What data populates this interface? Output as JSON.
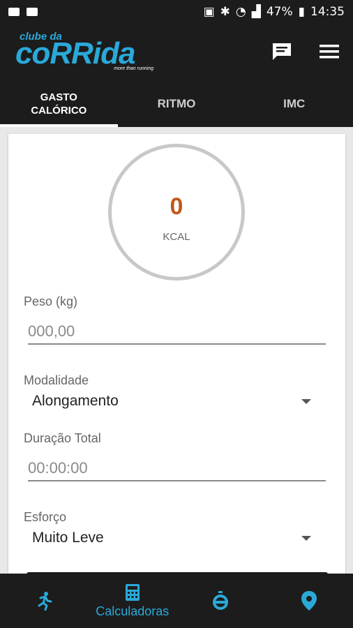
{
  "status": {
    "battery": "47%",
    "time": "14:35"
  },
  "app": {
    "logo_small": "clube da",
    "logo_main": "coRRida",
    "logo_tag": "more than running"
  },
  "tabs": [
    {
      "label": "GASTO\nCALÓRICO",
      "active": true
    },
    {
      "label": "RITMO"
    },
    {
      "label": "IMC"
    }
  ],
  "result": {
    "value": "0",
    "unit": "KCAL"
  },
  "form": {
    "peso_label": "Peso (kg)",
    "peso_placeholder": "000,00",
    "modalidade_label": "Modalidade",
    "modalidade_value": "Alongamento",
    "duracao_label": "Duração Total",
    "duracao_placeholder": "00:00:00",
    "esforco_label": "Esforço",
    "esforco_value": "Muito Leve"
  },
  "bottom_nav": {
    "calculadoras_label": "Calculadoras"
  },
  "colors": {
    "accent": "#2aa9d9",
    "result": "#c0581a",
    "bar": "#1c1c1c"
  }
}
